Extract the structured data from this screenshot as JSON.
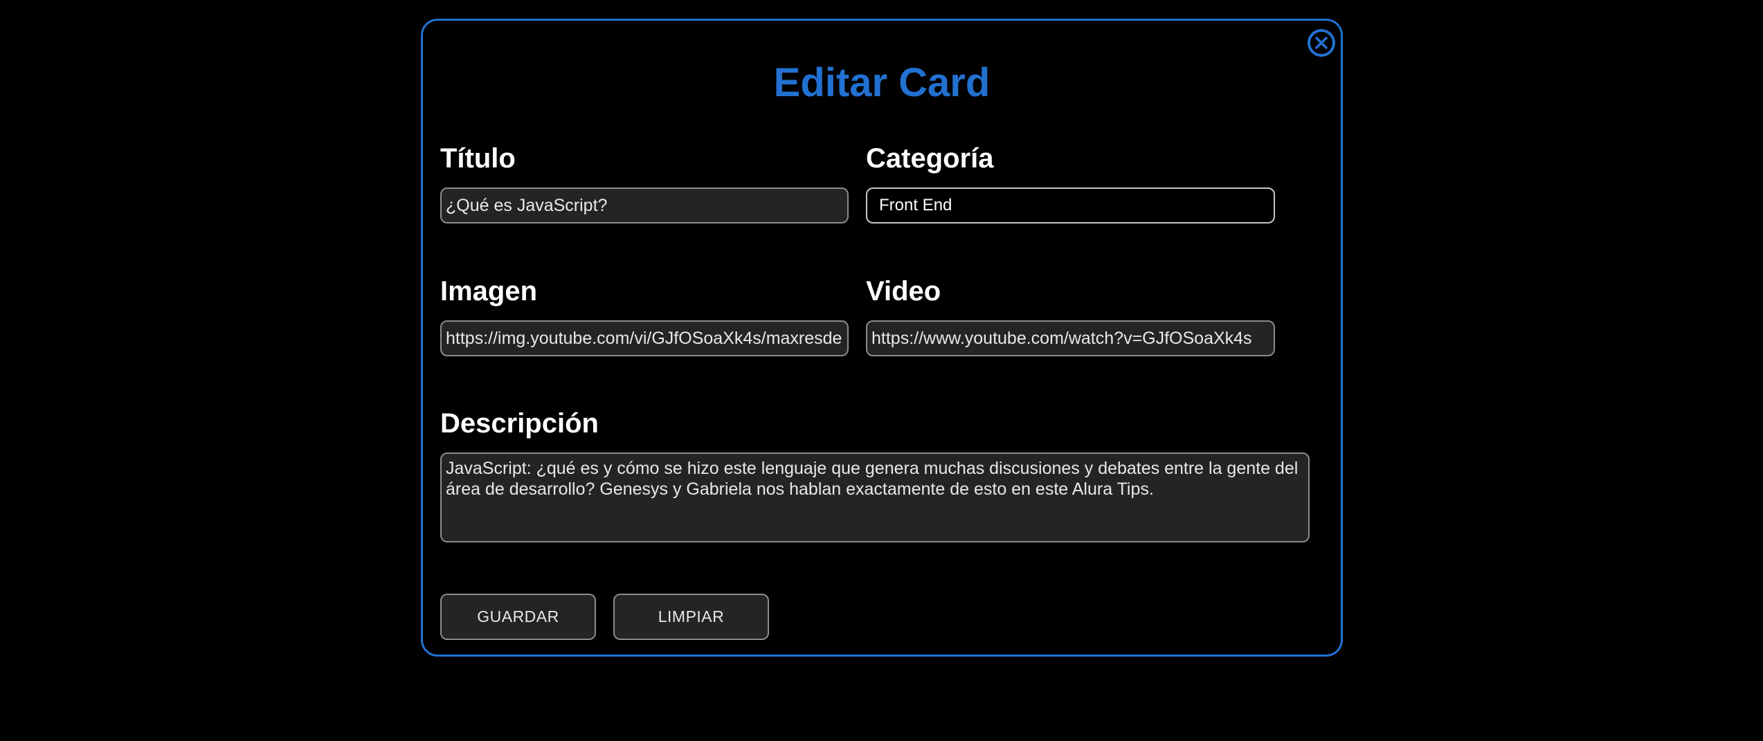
{
  "modal": {
    "title": "Editar Card",
    "close_icon": "close-circle-icon"
  },
  "fields": {
    "titulo": {
      "label": "Título",
      "value": "¿Qué es JavaScript?"
    },
    "categoria": {
      "label": "Categoría",
      "value": "Front End"
    },
    "imagen": {
      "label": "Imagen",
      "value": "https://img.youtube.com/vi/GJfOSoaXk4s/maxresde"
    },
    "video": {
      "label": "Video",
      "value": "https://www.youtube.com/watch?v=GJfOSoaXk4s"
    },
    "descripcion": {
      "label": "Descripción",
      "value": "JavaScript: ¿qué es y cómo se hizo este lenguaje que genera muchas discusiones y debates entre la gente del área de desarrollo? Genesys y Gabriela nos hablan exactamente de esto en este Alura Tips."
    }
  },
  "buttons": {
    "save_label": "GUARDAR",
    "clear_label": "LIMPIAR"
  },
  "colors": {
    "accent": "#2271d1",
    "background": "#000000",
    "field_background": "#242424"
  }
}
